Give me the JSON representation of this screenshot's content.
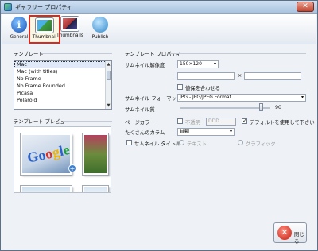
{
  "window": {
    "title": "ギャラリー プロパティ"
  },
  "toolbar": {
    "general": "General",
    "thumbnail": "Thumbnail",
    "thumbnails": "Thumbnails",
    "publish": "Publish"
  },
  "templates": {
    "section_title": "テンプレート",
    "items": [
      "Mac",
      "Mac (with titles)",
      "No Frame",
      "No Frame Rounded",
      "Picasa",
      "Polaroid"
    ],
    "selected": "Mac"
  },
  "preview": {
    "section_title": "テンプレート プレビュー"
  },
  "template_props": {
    "section_title": "テンプレート プロパティ",
    "thumb_size_label": "サムネイル解像度",
    "thumb_size_value": "150×120",
    "x_sep": "×",
    "fit_label": "値保を合わせる",
    "format_label": "サムネイル フォーマット",
    "format_value": "JPG - JPG/JPEG Format",
    "quality_label": "サムネイル質",
    "quality_value": "90",
    "bg_label": "ページカラー",
    "transparent_label": "不透明",
    "color_value": "DDD",
    "use_default_label": "デフォルトを使用して下さい",
    "columns_label": "たくさんのカラム",
    "columns_value": "自動",
    "thumb_title_label": "サムネイル タイトル",
    "text_label": "テキスト",
    "graphic_label": "グラフィック"
  },
  "footer": {
    "close_label": "閉じる"
  }
}
